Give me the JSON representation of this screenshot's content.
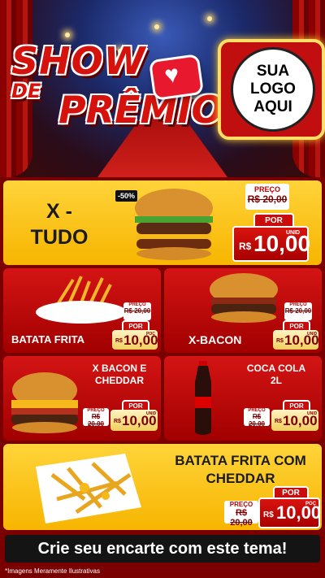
{
  "hero": {
    "title_line1": "SHOW",
    "title_line2": "DE",
    "title_line3": "PRÊMIOS",
    "logo_text": "SUA\nLOGO\nAQUI"
  },
  "featured": {
    "name": "X -\nTUDO",
    "discount": "-50%",
    "old_label": "PREÇO",
    "old_price": "R$ 20,00",
    "por_label": "POR",
    "currency": "R$",
    "price": "10,00",
    "unit": "UNID"
  },
  "items": [
    {
      "name": "BATATA FRITA",
      "old_label": "PREÇO",
      "old_price": "R$ 20,00",
      "por_label": "POR",
      "currency": "R$",
      "price": "10,00",
      "unit": "POÇ"
    },
    {
      "name": "X-BACON",
      "old_label": "PREÇO",
      "old_price": "R$ 20,00",
      "por_label": "POR",
      "currency": "R$",
      "price": "10,00",
      "unit": "UNID"
    },
    {
      "name": "X BACON E\nCHEDDAR",
      "old_label": "PREÇO",
      "old_price": "R$ 20,00",
      "por_label": "POR",
      "currency": "R$",
      "price": "10,00",
      "unit": "UNID"
    },
    {
      "name": "COCA COLA\n2L",
      "old_label": "PREÇO",
      "old_price": "R$ 20,00",
      "por_label": "POR",
      "currency": "R$",
      "price": "10,00",
      "unit": "UNID"
    }
  ],
  "bottom": {
    "name": "BATATA FRITA COM\nCHEDDAR",
    "old_label": "PREÇO",
    "old_price": "R$ 20,00",
    "por_label": "POR",
    "currency": "R$",
    "price": "10,00",
    "unit": "POÇ"
  },
  "footer": {
    "cta": "Crie seu encarte com este tema!",
    "disclaimer": "*Imagens Meramente Ilustrativas"
  },
  "colors": {
    "primary_red": "#d41414",
    "yellow": "#ffd43a",
    "dark": "#141414"
  }
}
